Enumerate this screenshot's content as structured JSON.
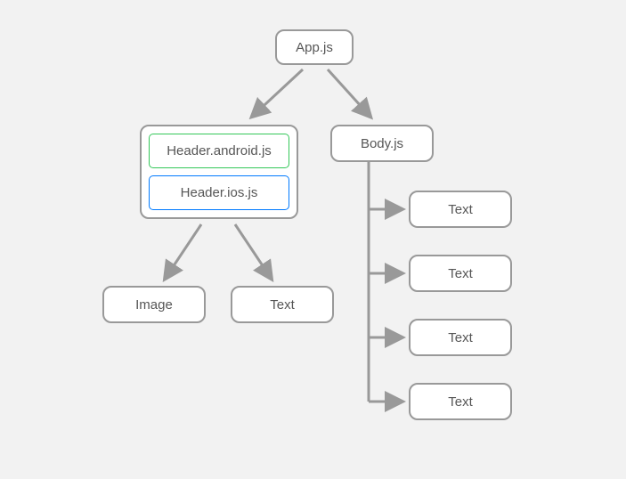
{
  "nodes": {
    "app": "App.js",
    "header_android": "Header.android.js",
    "header_ios": "Header.ios.js",
    "body": "Body.js",
    "image": "Image",
    "text_header": "Text",
    "body_text_1": "Text",
    "body_text_2": "Text",
    "body_text_3": "Text",
    "body_text_4": "Text"
  }
}
